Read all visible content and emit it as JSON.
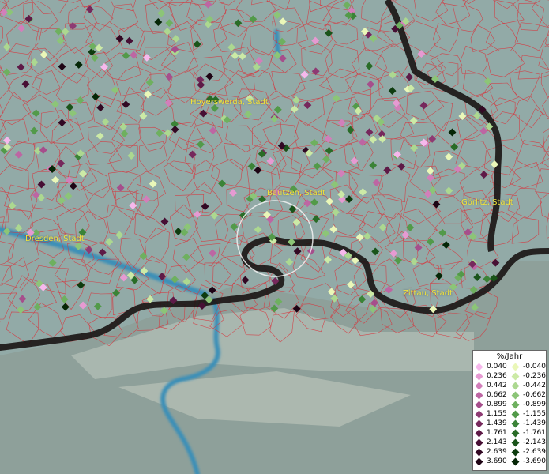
{
  "cities": [
    {
      "name": "Hoyerswerda, Stadt"
    },
    {
      "name": "Bautzen, Stadt"
    },
    {
      "name": "Görlitz, Stadt"
    },
    {
      "name": "Dresden, Stadt"
    },
    {
      "name": "Zittau, Stadt"
    }
  ],
  "legend": {
    "title": "%/Jahr",
    "positive": [
      {
        "label": "0.040",
        "color": "#f6b8ec"
      },
      {
        "label": "0.236",
        "color": "#e69ad2"
      },
      {
        "label": "0.442",
        "color": "#d27fba"
      },
      {
        "label": "0.662",
        "color": "#bd66a3"
      },
      {
        "label": "0.899",
        "color": "#a64e8c"
      },
      {
        "label": "1.155",
        "color": "#8e3a73"
      },
      {
        "label": "1.439",
        "color": "#76285c"
      },
      {
        "label": "1.761",
        "color": "#5e1a47"
      },
      {
        "label": "2.143",
        "color": "#470f34"
      },
      {
        "label": "2.639",
        "color": "#320823"
      },
      {
        "label": "3.690",
        "color": "#1e0414"
      }
    ],
    "negative": [
      {
        "label": "-0.040",
        "color": "#eaf7b8"
      },
      {
        "label": "-0.236",
        "color": "#cceaa6"
      },
      {
        "label": "-0.442",
        "color": "#acd890"
      },
      {
        "label": "-0.662",
        "color": "#8cc577"
      },
      {
        "label": "-0.899",
        "color": "#6eb05f"
      },
      {
        "label": "-1.155",
        "color": "#529a49"
      },
      {
        "label": "-1.439",
        "color": "#3b8337"
      },
      {
        "label": "-1.761",
        "color": "#296c27"
      },
      {
        "label": "-2.143",
        "color": "#1a541a"
      },
      {
        "label": "-2.639",
        "color": "#0e3c0f"
      },
      {
        "label": "-3.690",
        "color": "#052606"
      }
    ]
  },
  "colors": {
    "boundary": "#d9323a",
    "border": "#1a1414",
    "river": "#3a8fb8",
    "background": "#8fa7a4",
    "label": "#f2e33a"
  }
}
